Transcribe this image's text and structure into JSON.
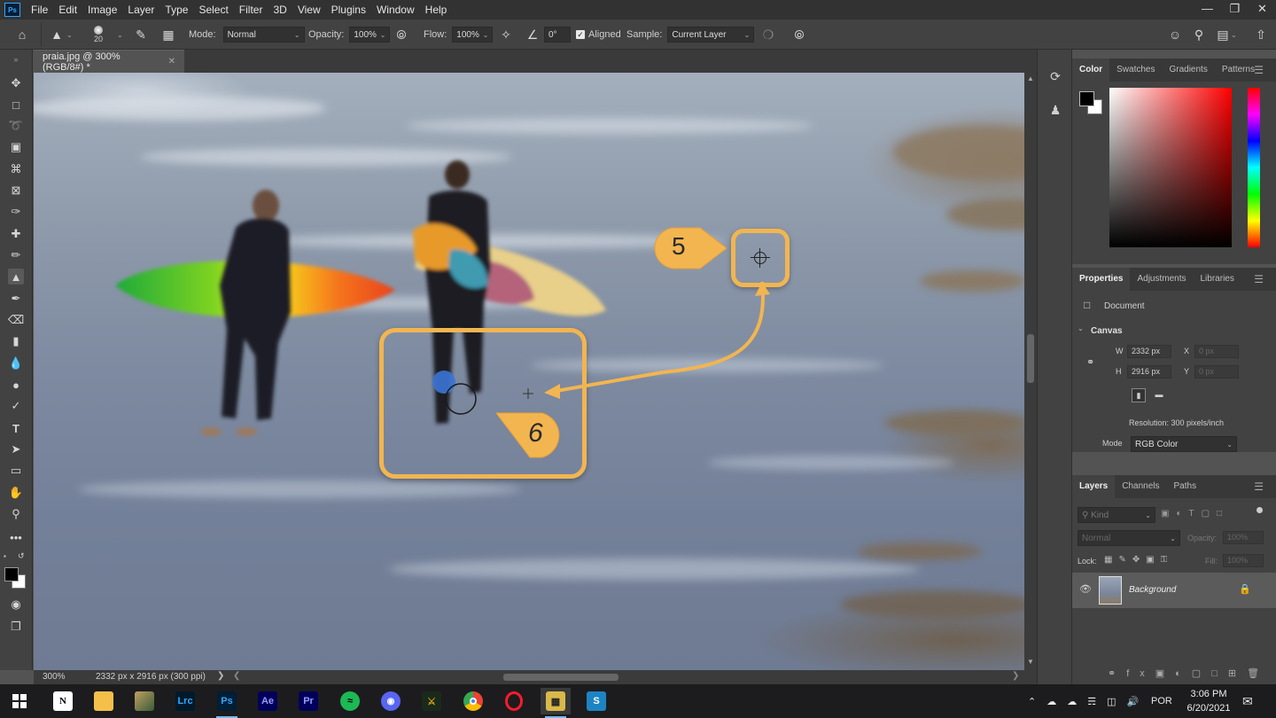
{
  "app": {
    "logo": "Ps",
    "menu": [
      "File",
      "Edit",
      "Image",
      "Layer",
      "Type",
      "Select",
      "Filter",
      "3D",
      "View",
      "Plugins",
      "Window",
      "Help"
    ],
    "window_controls": [
      "minimize-icon",
      "restore-icon",
      "close-icon"
    ]
  },
  "options": {
    "brush_size": "20",
    "mode_label": "Mode:",
    "mode_value": "Normal",
    "opacity_label": "Opacity:",
    "opacity_value": "100%",
    "flow_label": "Flow:",
    "flow_value": "100%",
    "angle_value": "0°",
    "aligned_label": "Aligned",
    "sample_label": "Sample:",
    "sample_value": "Current Layer"
  },
  "document": {
    "tab_title": "praia.jpg @ 300% (RGB/8#) *",
    "zoom": "300%",
    "doc_info": "2332 px x 2916 px (300 ppi)"
  },
  "callouts": {
    "step5": "5",
    "step6": "6",
    "accent": "#f2b550"
  },
  "color_panel": {
    "tabs": [
      "Color",
      "Swatches",
      "Gradients",
      "Patterns"
    ],
    "foreground": "#000000",
    "background": "#ffffff"
  },
  "properties_panel": {
    "tabs": [
      "Properties",
      "Adjustments",
      "Libraries"
    ],
    "type": "Document",
    "section": "Canvas",
    "w_label": "W",
    "w_value": "2332 px",
    "h_label": "H",
    "h_value": "2916 px",
    "x_label": "X",
    "x_placeholder": "0 px",
    "y_label": "Y",
    "y_placeholder": "0 px",
    "resolution": "Resolution: 300 pixels/inch",
    "mode_label": "Mode",
    "mode_value": "RGB Color"
  },
  "layers_panel": {
    "tabs": [
      "Layers",
      "Channels",
      "Paths"
    ],
    "filter_placeholder": "Kind",
    "blend_mode": "Normal",
    "opacity_label": "Opacity:",
    "opacity_value": "100%",
    "lock_label": "Lock:",
    "fill_label": "Fill:",
    "fill_value": "100%",
    "layer_name": "Background"
  },
  "taskbar": {
    "apps": [
      "windows-start-icon",
      "N",
      "files-folder-icon",
      "photo-app-icon",
      "Lrc",
      "Ps",
      "Ae",
      "Pr",
      "spotify-icon",
      "discord-icon",
      "game-icon",
      "chrome-icon",
      "opera-icon",
      "video-app-icon",
      "S"
    ],
    "language": "POR",
    "time": "3:06 PM",
    "date": "6/20/2021"
  }
}
